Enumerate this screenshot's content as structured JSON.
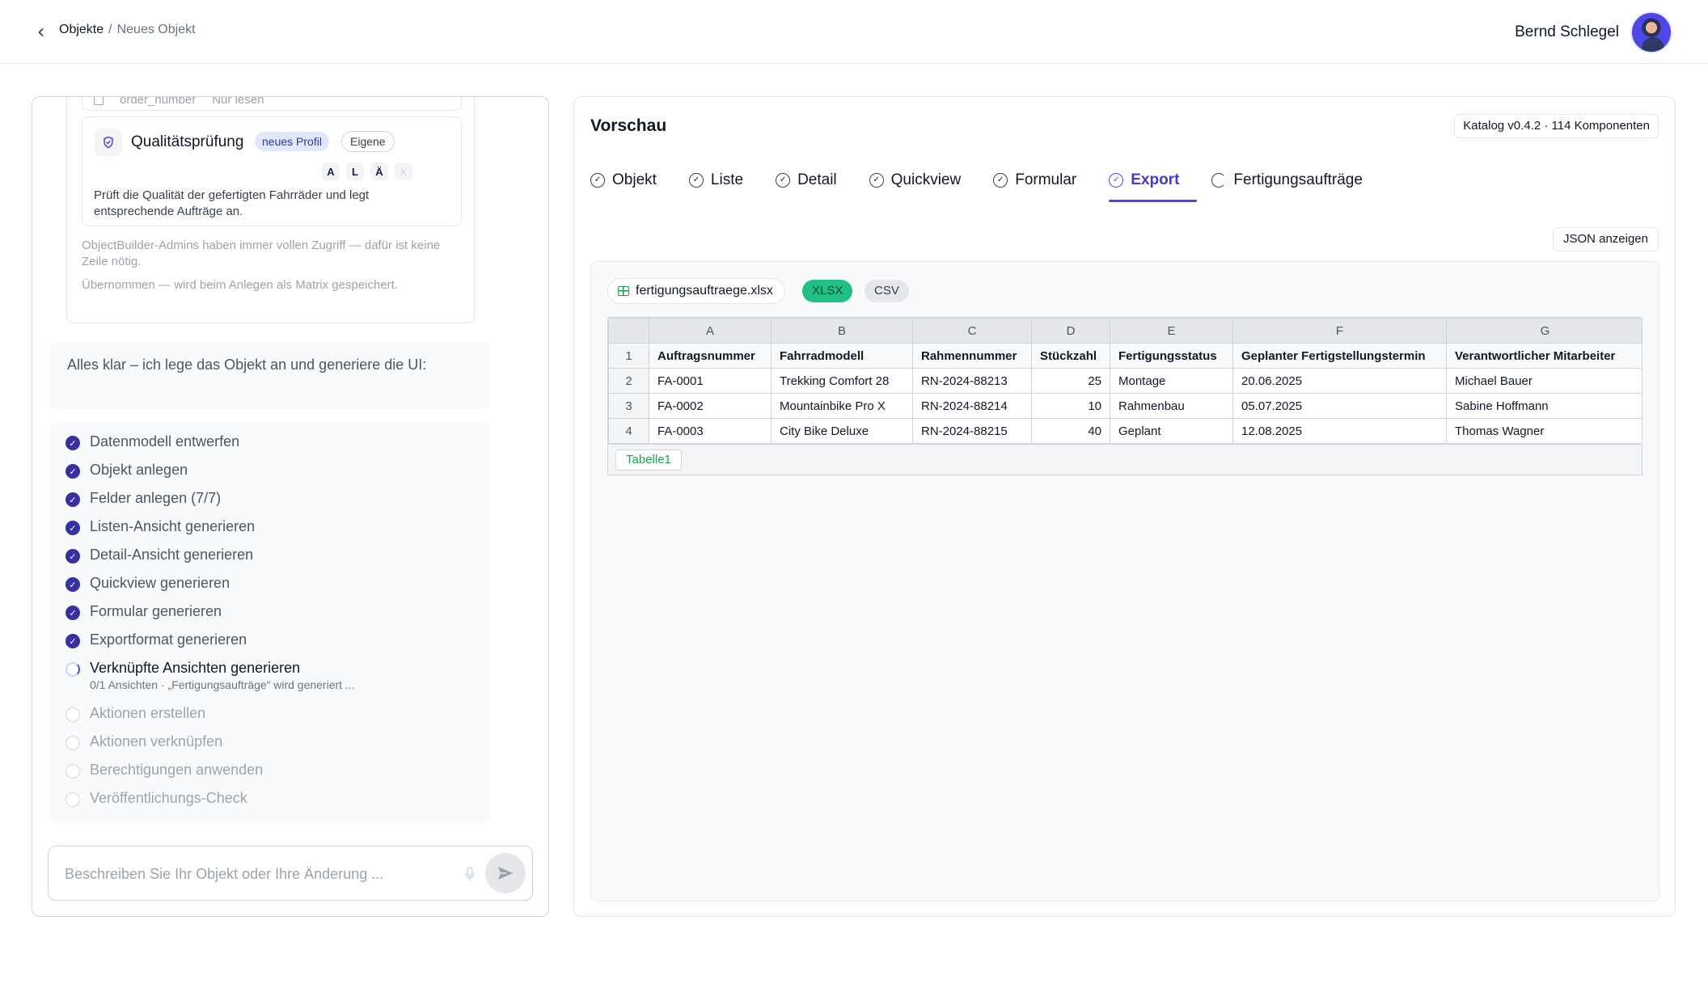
{
  "header": {
    "breadcrumb_root": "Objekte",
    "breadcrumb_sep": "/",
    "breadcrumb_current": "Neues Objekt",
    "user_name": "Bernd Schlegel"
  },
  "left": {
    "partial_row": {
      "field": "order_number",
      "access": "Nur lesen"
    },
    "role": {
      "title": "Qualitätsprüfung",
      "badge_new": "neues Profil",
      "badge_own": "Eigene",
      "permissions": [
        "A",
        "L",
        "Ä",
        "X"
      ],
      "description": "Prüft die Qualität der gefertigten Fahrräder und legt entsprechende Aufträge an."
    },
    "info_admin": "ObjectBuilder-Admins haben immer vollen Zugriff — dafür ist keine Zeile nötig.",
    "info_matrix": "Übernommen — wird beim Anlegen als Matrix gespeichert.",
    "message": "Alles klar – ich lege das Objekt an und generiere die UI:",
    "steps": [
      {
        "label": "Datenmodell entwerfen",
        "state": "done"
      },
      {
        "label": "Objekt anlegen",
        "state": "done"
      },
      {
        "label": "Felder anlegen (7/7)",
        "state": "done"
      },
      {
        "label": "Listen-Ansicht generieren",
        "state": "done"
      },
      {
        "label": "Detail-Ansicht generieren",
        "state": "done"
      },
      {
        "label": "Quickview generieren",
        "state": "done"
      },
      {
        "label": "Formular generieren",
        "state": "done"
      },
      {
        "label": "Exportformat generieren",
        "state": "done"
      },
      {
        "label": "Verknüpfte Ansichten generieren",
        "state": "running",
        "sub": "0/1 Ansichten · „Fertigungsaufträge“ wird generiert ..."
      },
      {
        "label": "Aktionen erstellen",
        "state": "pending"
      },
      {
        "label": "Aktionen verknüpfen",
        "state": "pending"
      },
      {
        "label": "Berechtigungen anwenden",
        "state": "pending"
      },
      {
        "label": "Veröffentlichungs-Check",
        "state": "pending"
      }
    ],
    "input_placeholder": "Beschreiben Sie Ihr Objekt oder Ihre Änderung ..."
  },
  "right": {
    "title": "Vorschau",
    "catalog": "Katalog v0.4.2 · 114 Komponenten",
    "tabs": [
      {
        "label": "Objekt"
      },
      {
        "label": "Liste"
      },
      {
        "label": "Detail"
      },
      {
        "label": "Quickview"
      },
      {
        "label": "Formular"
      },
      {
        "label": "Export"
      },
      {
        "label": "Fertigungsaufträge"
      }
    ],
    "json_button": "JSON anzeigen",
    "file_name": "fertigungsauftraege.xlsx",
    "format_xlsx": "XLSX",
    "format_csv": "CSV",
    "sheet": {
      "column_letters": [
        "A",
        "B",
        "C",
        "D",
        "E",
        "F",
        "G"
      ],
      "row_numbers": [
        "1",
        "2",
        "3",
        "4"
      ],
      "headers": [
        "Auftragsnummer",
        "Fahrradmodell",
        "Rahmennummer",
        "Stückzahl",
        "Fertigungsstatus",
        "Geplanter Fertigstellungstermin",
        "Verantwortlicher Mitarbeiter"
      ],
      "rows": [
        [
          "FA-0001",
          "Trekking Comfort 28",
          "RN-2024-88213",
          "25",
          "Montage",
          "20.06.2025",
          "Michael Bauer"
        ],
        [
          "FA-0002",
          "Mountainbike Pro X",
          "RN-2024-88214",
          "10",
          "Rahmenbau",
          "05.07.2025",
          "Sabine Hoffmann"
        ],
        [
          "FA-0003",
          "City Bike Deluxe",
          "RN-2024-88215",
          "40",
          "Geplant",
          "12.08.2025",
          "Thomas Wagner"
        ]
      ],
      "tab_name": "Tabelle1"
    }
  }
}
